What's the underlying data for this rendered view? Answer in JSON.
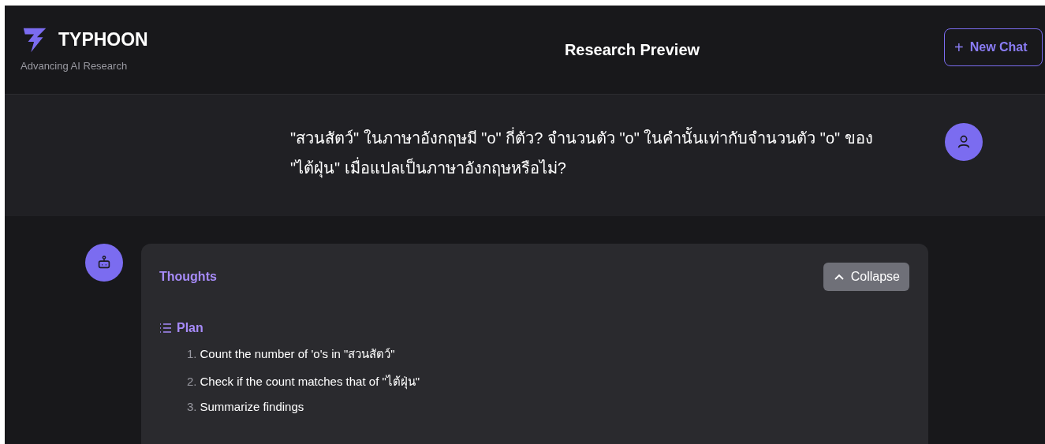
{
  "header": {
    "brand": "TYPHOON",
    "tagline": "Advancing AI Research",
    "title": "Research Preview",
    "new_chat_button": {
      "icon": "+",
      "label": "New Chat"
    }
  },
  "user_message": {
    "text": "\"สวนสัตว์\" ในภาษาอังกฤษมี \"o\" กี่ตัว? จำนวนตัว \"o\" ในคำนั้นเท่ากับจำนวนตัว \"o\" ของ \"ไต้ฝุ่น\" เมื่อแปลเป็นภาษาอังกฤษหรือไม่?"
  },
  "thoughts": {
    "title": "Thoughts",
    "expanded": true,
    "collapse_button": "Collapse",
    "plan_title": "Plan",
    "steps": [
      {
        "number": "1.",
        "text": "Count the number of 'o's in \"สวนสัตว์\""
      },
      {
        "number": "2.",
        "text": "Check if the count matches that of \"ไต้ฝุ่น\""
      },
      {
        "number": "3.",
        "text": "Summarize findings"
      }
    ]
  }
}
